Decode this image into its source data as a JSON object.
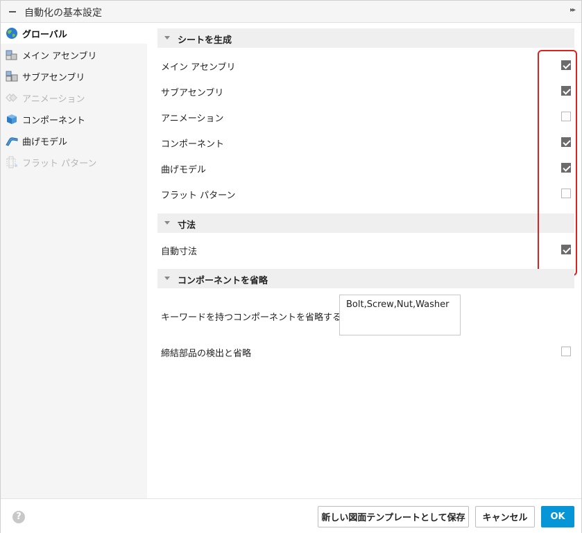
{
  "titlebar": {
    "title": "自動化の基本設定",
    "expand_glyph": "▸▸"
  },
  "sidebar": {
    "items": [
      {
        "label": "グローバル",
        "icon": "globe-icon",
        "state": "active"
      },
      {
        "label": "メイン アセンブリ",
        "icon": "assembly-icon",
        "state": "normal"
      },
      {
        "label": "サブアセンブリ",
        "icon": "subassembly-icon",
        "state": "normal"
      },
      {
        "label": "アニメーション",
        "icon": "animation-icon",
        "state": "disabled"
      },
      {
        "label": "コンポーネント",
        "icon": "component-icon",
        "state": "normal"
      },
      {
        "label": "曲げモデル",
        "icon": "bend-model-icon",
        "state": "normal"
      },
      {
        "label": "フラット パターン",
        "icon": "flat-pattern-icon",
        "state": "disabled"
      }
    ]
  },
  "sections": {
    "sheets": {
      "title": "シートを生成",
      "rows": [
        {
          "label": "メイン アセンブリ",
          "checked": true
        },
        {
          "label": "サブアセンブリ",
          "checked": true
        },
        {
          "label": "アニメーション",
          "checked": false
        },
        {
          "label": "コンポーネント",
          "checked": true
        },
        {
          "label": "曲げモデル",
          "checked": true
        },
        {
          "label": "フラット パターン",
          "checked": false
        }
      ]
    },
    "dims": {
      "title": "寸法",
      "rows": [
        {
          "label": "自動寸法",
          "checked": true
        }
      ]
    },
    "omit": {
      "title": "コンポーネントを省略",
      "keyword_label": "キーワードを持つコンポーネントを省略する",
      "keyword_value": "Bolt,Screw,Nut,Washer",
      "fastener_label": "締結部品の検出と省略",
      "fastener_checked": false
    }
  },
  "footer": {
    "help": "?",
    "save_template": "新しい図面テンプレートとして保存",
    "cancel": "キャンセル",
    "ok": "OK"
  },
  "colors": {
    "accent": "#0696d7",
    "highlight": "#e02020",
    "checkbox_checked": "#6b6b6b"
  }
}
